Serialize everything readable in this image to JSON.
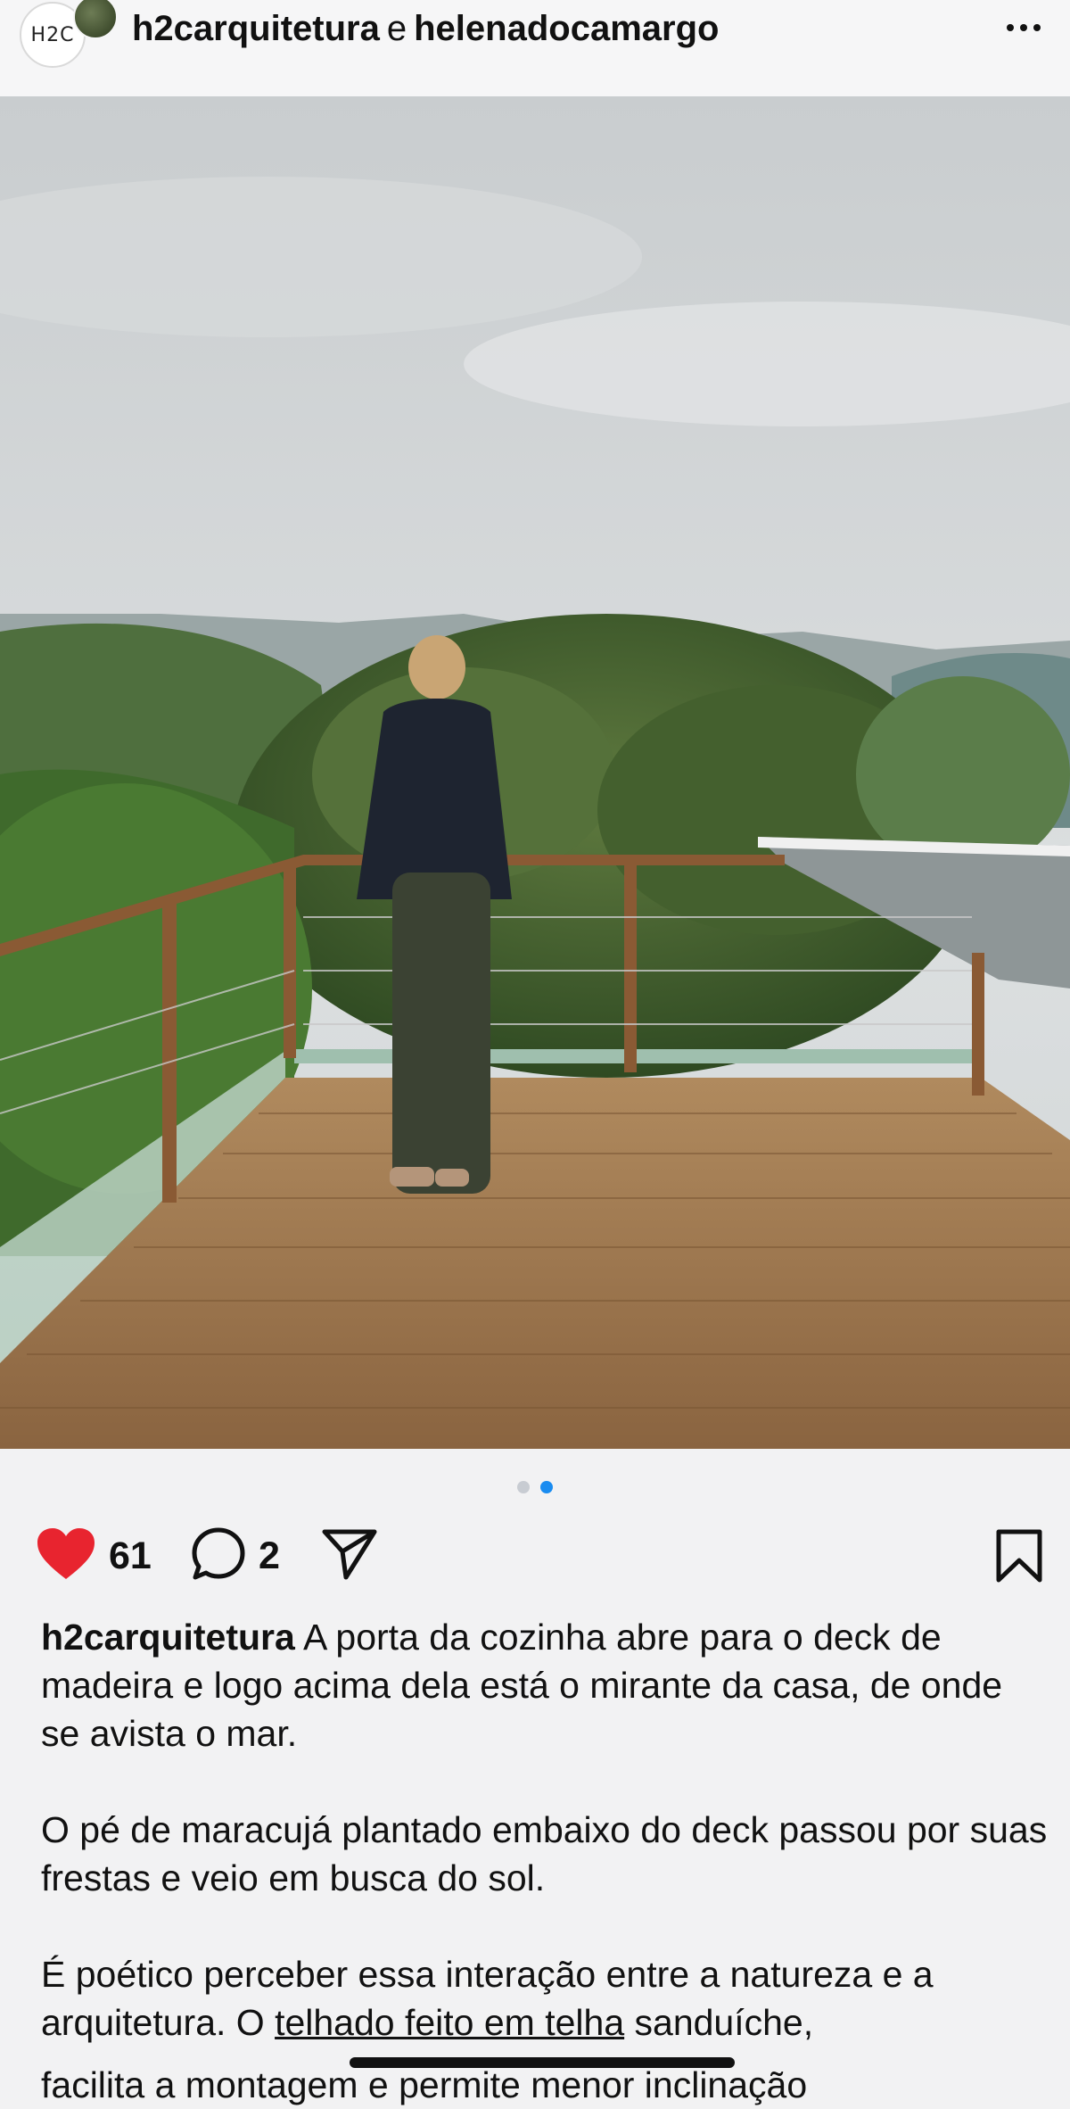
{
  "header": {
    "account1": "h2carquitetura",
    "conjunction": "e",
    "account2": "helenadocamargo",
    "avatar_text": "H2C"
  },
  "carousel": {
    "current": 2,
    "total": 2
  },
  "actions": {
    "likes": "61",
    "comments": "2"
  },
  "caption": {
    "username": "h2carquitetura",
    "p1": "A porta da cozinha abre para o deck de madeira e logo acima dela está o mirante da casa, de onde se avista o mar.",
    "p2": "O pé de maracujá plantado embaixo do deck passou por suas frestas e veio em busca do sol.",
    "p3_a": "É poético perceber essa interação entre a natureza e a arquitetura. O ",
    "p3_link": "telhado feito em telha",
    "p3_b": " sanduíche,",
    "p3_cut": "facilita a montagem e permite menor inclinação"
  },
  "colors": {
    "like": "#e8242f",
    "dot_active": "#1a8cf0"
  }
}
